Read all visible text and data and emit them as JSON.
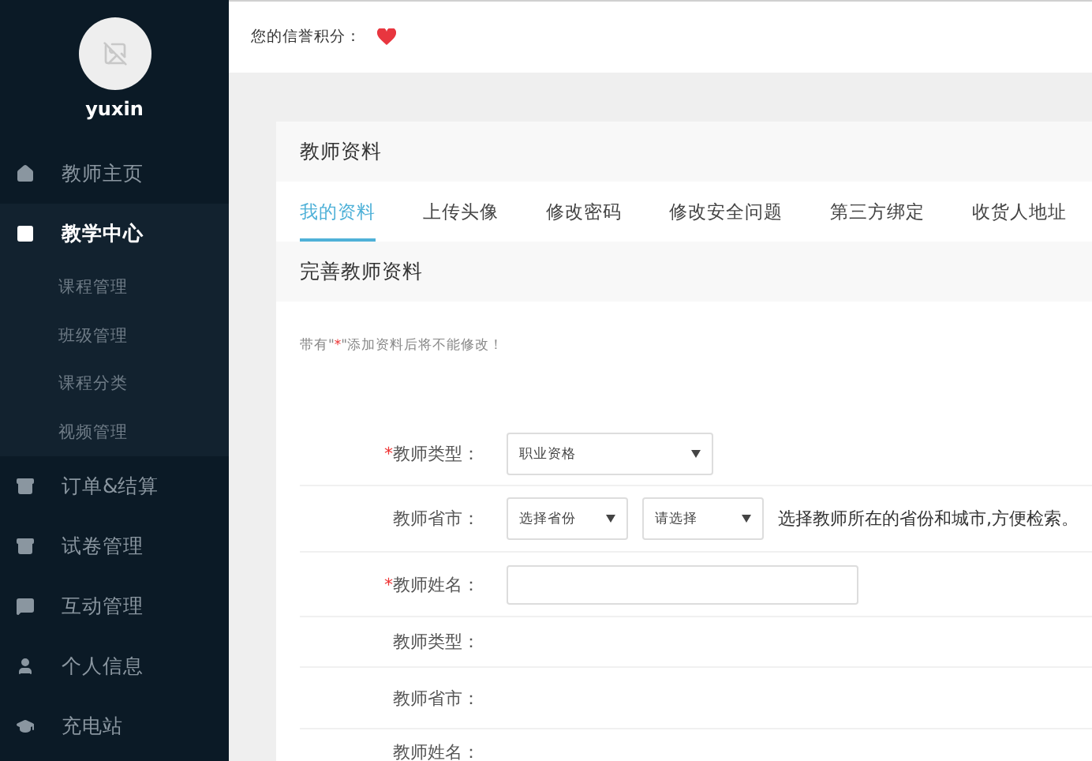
{
  "sidebar": {
    "user": {
      "name": "yuxin"
    },
    "items": [
      {
        "label": "教师主页",
        "selected": false
      },
      {
        "label": "教学中心",
        "selected": true,
        "children": [
          {
            "label": "课程管理"
          },
          {
            "label": "班级管理"
          },
          {
            "label": "课程分类"
          },
          {
            "label": "视频管理"
          }
        ]
      },
      {
        "label": "订单&结算",
        "selected": false
      },
      {
        "label": "试卷管理",
        "selected": false
      },
      {
        "label": "互动管理",
        "selected": false
      },
      {
        "label": "个人信息",
        "selected": false
      },
      {
        "label": "充电站",
        "selected": false
      }
    ]
  },
  "top_bar": {
    "credit_label": "您的信誉积分："
  },
  "card": {
    "title": "教师资料",
    "tabs": [
      {
        "label": "我的资料",
        "selected": true
      },
      {
        "label": "上传头像",
        "selected": false
      },
      {
        "label": "修改密码",
        "selected": false
      },
      {
        "label": "修改安全问题",
        "selected": false
      },
      {
        "label": "第三方绑定",
        "selected": false
      },
      {
        "label": "收货人地址",
        "selected": false
      }
    ],
    "section_title": "完善教师资料",
    "note": {
      "before": "带有\"",
      "mark": "*",
      "after": "\"添加资料后将不能修改！"
    },
    "rows": [
      {
        "kind": "select",
        "label": "教师类型：",
        "required": true,
        "selects": [
          {
            "value": "职业资格"
          }
        ]
      },
      {
        "kind": "select",
        "label": "教师省市：",
        "required": false,
        "selects": [
          {
            "value": "选择省份"
          },
          {
            "value": "请选择"
          }
        ],
        "hint": "选择教师所在的省份和城市,方便检索。"
      },
      {
        "kind": "input",
        "label": "教师姓名：",
        "required": true
      },
      {
        "kind": "text",
        "label": "教师类型：",
        "required": false
      },
      {
        "kind": "text",
        "label": "教师省市：",
        "required": false
      },
      {
        "kind": "text",
        "label": "教师姓名：",
        "required": false
      }
    ]
  }
}
